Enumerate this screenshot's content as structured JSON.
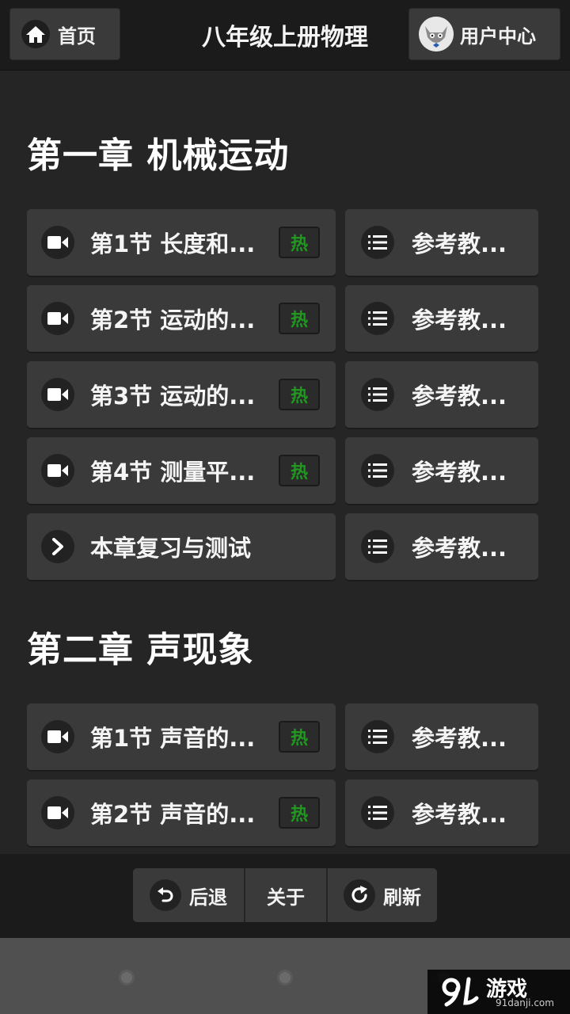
{
  "header": {
    "home_label": "首页",
    "title": "八年级上册物理",
    "user_label": "用户中心"
  },
  "chapters": [
    {
      "title": "第一章 机械运动",
      "rows": [
        {
          "lesson": "第1节 长度和...",
          "hot": "热",
          "ref": "参考教..."
        },
        {
          "lesson": "第2节 运动的...",
          "hot": "热",
          "ref": "参考教..."
        },
        {
          "lesson": "第3节 运动的...",
          "hot": "热",
          "ref": "参考教..."
        },
        {
          "lesson": "第4节 测量平...",
          "hot": "热",
          "ref": "参考教..."
        },
        {
          "lesson": "本章复习与测试",
          "ref": "参考教..."
        }
      ]
    },
    {
      "title": "第二章 声现象",
      "rows": [
        {
          "lesson": "第1节 声音的...",
          "hot": "热",
          "ref": "参考教..."
        },
        {
          "lesson": "第2节 声音的...",
          "hot": "热",
          "ref": "参考教..."
        }
      ]
    }
  ],
  "footer": {
    "back_label": "后退",
    "about_label": "关于",
    "refresh_label": "刷新"
  },
  "watermark": {
    "brand": "游戏",
    "site": "91danji.com"
  },
  "colors": {
    "background": "#252525",
    "card": "#3a3a3a",
    "hot_text": "#1f9a1f"
  }
}
